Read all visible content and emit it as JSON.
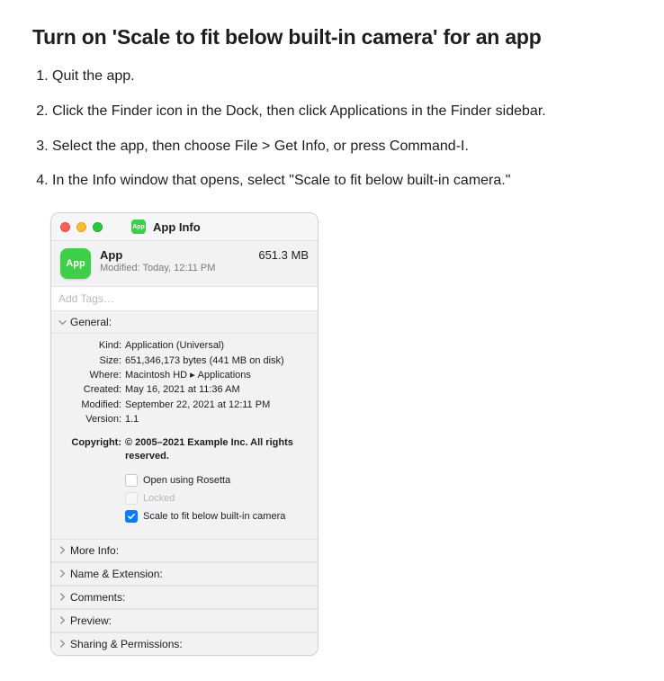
{
  "heading": "Turn on 'Scale to fit below built-in camera' for an app",
  "steps": [
    "Quit the app.",
    "Click the Finder icon in the Dock, then click Applications in the Finder sidebar.",
    "Select the app, then choose File > Get Info, or press Command-I.",
    "In the Info window that opens, select \"Scale to fit below built-in camera.\""
  ],
  "window": {
    "icon_label": "App",
    "title": "App Info",
    "app_name": "App",
    "modified_line": "Modified: Today, 12:11 PM",
    "size": "651.3 MB",
    "tags_placeholder": "Add Tags…"
  },
  "general": {
    "header": "General:",
    "kind_label": "Kind:",
    "kind_value": "Application (Universal)",
    "size_label": "Size:",
    "size_value": "651,346,173 bytes (441 MB on disk)",
    "where_label": "Where:",
    "where_value_a": "Macintosh HD",
    "where_sep": "▸",
    "where_value_b": "Applications",
    "created_label": "Created:",
    "created_value": "May 16, 2021 at 11:36 AM",
    "modified_label": "Modified:",
    "modified_value": "September 22, 2021 at 12:11 PM",
    "version_label": "Version:",
    "version_value": "1.1",
    "copyright_label": "Copyright:",
    "copyright_value": "© 2005–2021 Example Inc. All rights reserved.",
    "checkboxes": {
      "rosetta": "Open using Rosetta",
      "locked": "Locked",
      "scale": "Scale to fit below built-in camera"
    }
  },
  "sections": {
    "more_info": "More Info:",
    "name_ext": "Name & Extension:",
    "comments": "Comments:",
    "preview": "Preview:",
    "sharing": "Sharing & Permissions:"
  }
}
